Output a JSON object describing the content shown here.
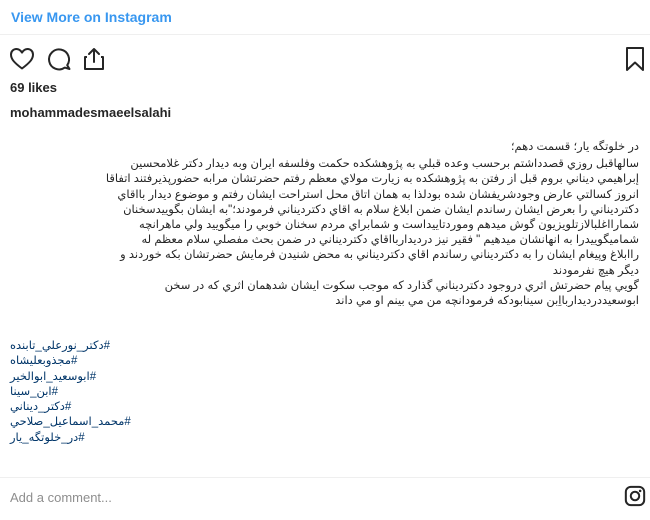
{
  "header": {
    "view_more_label": "View More on Instagram"
  },
  "actions": {
    "like_icon": "heart-icon",
    "comment_icon": "comment-icon",
    "share_icon": "share-icon",
    "save_icon": "bookmark-icon"
  },
  "post": {
    "likes": "69 likes",
    "username": "mohammadesmaeelsalahi",
    "caption_lines": [
      "در خلوتگه یار؛ قسمت دهم؛",
      "سالهاقبل روزي قصدداشتم برحسب وعده قبلي به پژوهشکده حکمت وفلسفه ایران وبه دیدار دکتر غلامحسین",
      "إبراهيمي ديناني بروم قبل از رفتن به پژوهشکده به زيارت مولاي معظم رفتم حضرتشان مرابه حضورپذيرفتند اتفاقا",
      "انروز کسالتي عارض وجودشريفشان شده بودلذا به همان اتاق محل استراحت ايشان رفتم و موضوع ديدار بااقاي",
      "دکترديناني را بعرض ايشان رساندم ايشان ضمن ابلاغ سلام به اقاي دکترديناني فرمودند؛\"به ايشان بگوييدسخنان",
      "شمارااغلبالازتلويزيون گوش ميدهم وموردتاييداست و شمابراي مردم سخنان خوبي را ميگوييد ولي ماهرانچه",
      "شماميگوييدرا به انهانشان ميدهيم \" فقير نيز دردیداربااقاي دکترديناني در ضمن بحث مفصلي سلام معظم له",
      "راابلاغ وپيغام ايشان را به دکترديناني رساندم اقاي دکترديناني به محض شنيدن فرمايش حضرتشان بکه خوردند و",
      "ديگر هيچ نفرمودند",
      "گويي پيام حضرتش اثري دروجود دکترديناني گذارد که موجب سکوت ايشان شدهمان اثري که در سخن",
      "ابوسعيددرديداربااِبن سينابودکه فرمودانچه من مي بينم او مي داند"
    ],
    "hashtags": [
      "#دکتر_نورعلي_تابنده",
      "#مجذوبعليشاه",
      "#ابوسعيد_ابوالخير",
      "#ابن_سينا",
      "#دکتر_ديناني",
      "#محمد_اسماعيل_صلاحي",
      "#در_خلوتگه_يار"
    ]
  },
  "comment": {
    "placeholder": "Add a comment...",
    "instagram_icon": "instagram-icon"
  },
  "colors": {
    "link_blue": "#3897f0",
    "hashtag_blue": "#003569",
    "text": "#262626",
    "placeholder": "#8e8e8e",
    "divider": "#efefef"
  }
}
